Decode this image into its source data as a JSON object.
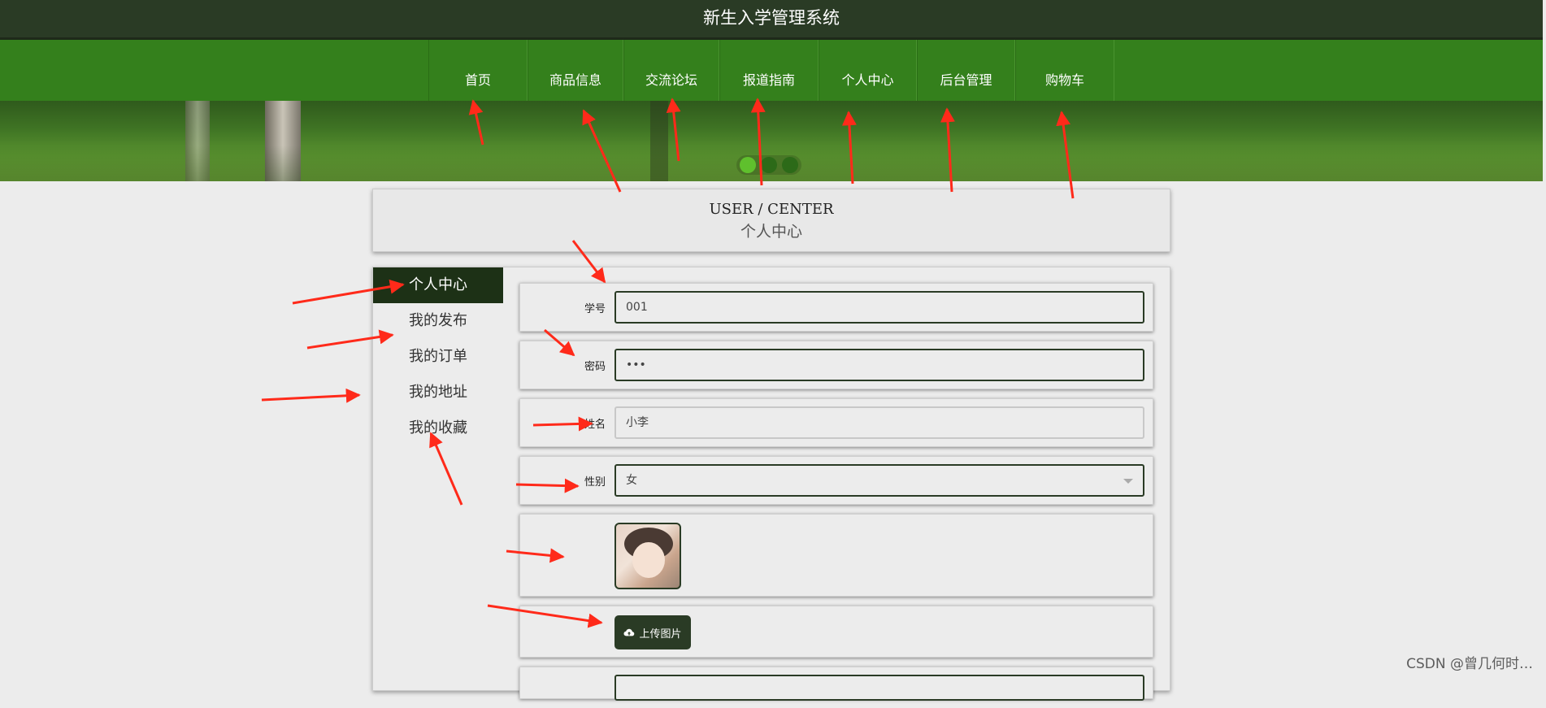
{
  "header": {
    "title": "新生入学管理系统"
  },
  "nav": {
    "items": [
      "首页",
      "商品信息",
      "交流论坛",
      "报道指南",
      "个人中心",
      "后台管理",
      "购物车"
    ]
  },
  "banner": {
    "slides": 3,
    "active_slide": 1
  },
  "center": {
    "title_en": "USER / CENTER",
    "title_cn": "个人中心"
  },
  "sidebar": {
    "items": [
      "个人中心",
      "我的发布",
      "我的订单",
      "我的地址",
      "我的收藏"
    ],
    "active": "个人中心"
  },
  "form": {
    "student_id": {
      "label": "学号",
      "value": "001"
    },
    "password": {
      "label": "密码",
      "value": "•••"
    },
    "name": {
      "label": "姓名",
      "value": "小李"
    },
    "gender": {
      "label": "性别",
      "value": "女"
    },
    "upload": {
      "label": "上传图片"
    }
  },
  "watermark": "CSDN @曾几何时…",
  "colors": {
    "title_bar": "#2a3b25",
    "nav": "#34801c",
    "active": "#1d3116",
    "arrow": "#ff2a1a"
  }
}
